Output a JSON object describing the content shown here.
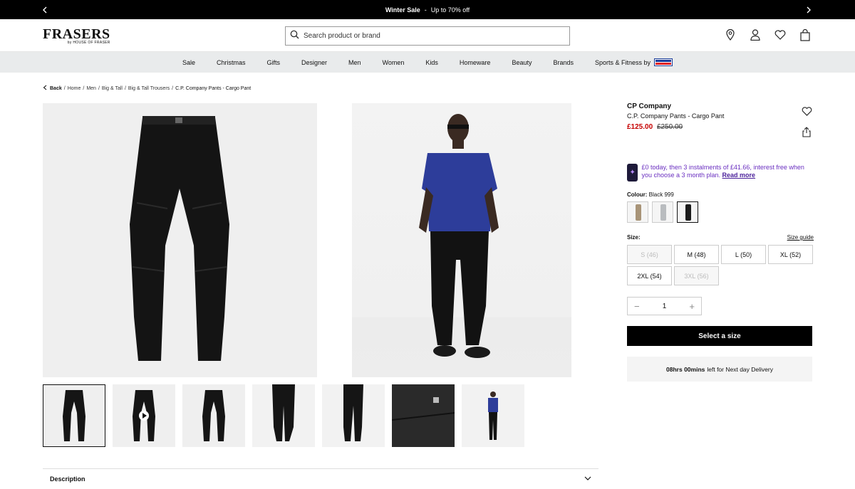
{
  "promo": {
    "title": "Winter Sale",
    "separator": "-",
    "text": "Up to 70% off"
  },
  "header": {
    "logo_main": "FRASERS",
    "logo_sub": "by HOUSE OF FRASER",
    "search_placeholder": "Search product or brand"
  },
  "nav": [
    "Sale",
    "Christmas",
    "Gifts",
    "Designer",
    "Men",
    "Women",
    "Kids",
    "Homeware",
    "Beauty",
    "Brands",
    "Sports & Fitness by"
  ],
  "breadcrumb": {
    "back": "Back",
    "items": [
      "Home",
      "Men",
      "Big & Tall",
      "Big & Tall Trousers"
    ],
    "current": "C.P. Company Pants - Cargo Pant",
    "sep": "/"
  },
  "product": {
    "brand": "CP Company",
    "name": "C.P. Company Pants - Cargo Pant",
    "price_now": "£125.00",
    "price_was": "£250.00"
  },
  "bnpl": {
    "text": "£0 today, then 3 instalments of £41.66, interest free when you choose a 3 month plan.",
    "link": "Read more"
  },
  "colour": {
    "label": "Colour:",
    "value": "Black 999",
    "swatches": [
      "#a89478",
      "#b9bcbf",
      "#1b1b1b"
    ]
  },
  "size": {
    "label": "Size:",
    "guide": "Size guide",
    "options": [
      {
        "label": "S (46)",
        "available": false
      },
      {
        "label": "M (48)",
        "available": true
      },
      {
        "label": "L (50)",
        "available": true
      },
      {
        "label": "XL (52)",
        "available": true
      },
      {
        "label": "2XL (54)",
        "available": true
      },
      {
        "label": "3XL (56)",
        "available": false
      }
    ]
  },
  "quantity": {
    "value": "1",
    "minus": "−",
    "plus": "+"
  },
  "cta": "Select a size",
  "delivery": {
    "time": "08hrs 00mins",
    "text": "left for Next day Delivery"
  },
  "description": {
    "label": "Description"
  },
  "colors": {
    "price_red": "#c60000",
    "bnpl_purple": "#6a2fc0"
  }
}
